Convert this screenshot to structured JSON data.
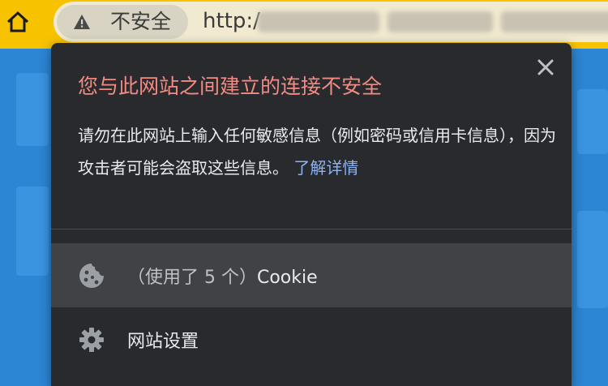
{
  "toolbar": {
    "security_label": "不安全",
    "url_prefix": "http:/",
    "url_suffix": "..."
  },
  "popup": {
    "title": "您与此网站之间建立的连接不安全",
    "description": "请勿在此网站上输入任何敏感信息（例如密码或信用卡信息），因为攻击者可能会盗取这些信息。",
    "learn_more": "了解详情",
    "cookie_prefix": "（使用了 5 个）",
    "cookie_label": "Cookie",
    "settings_label": "网站设置"
  },
  "colors": {
    "toolbar_bg": "#f7c300",
    "popup_bg": "#292a2d",
    "title_red": "#f28b82",
    "link_blue": "#8ab4f8",
    "highlight_row": "#414245"
  },
  "icons": {
    "home": "home-icon",
    "warning": "warning-icon",
    "close": "close-icon",
    "cookie": "cookie-icon",
    "settings": "gear-icon"
  }
}
